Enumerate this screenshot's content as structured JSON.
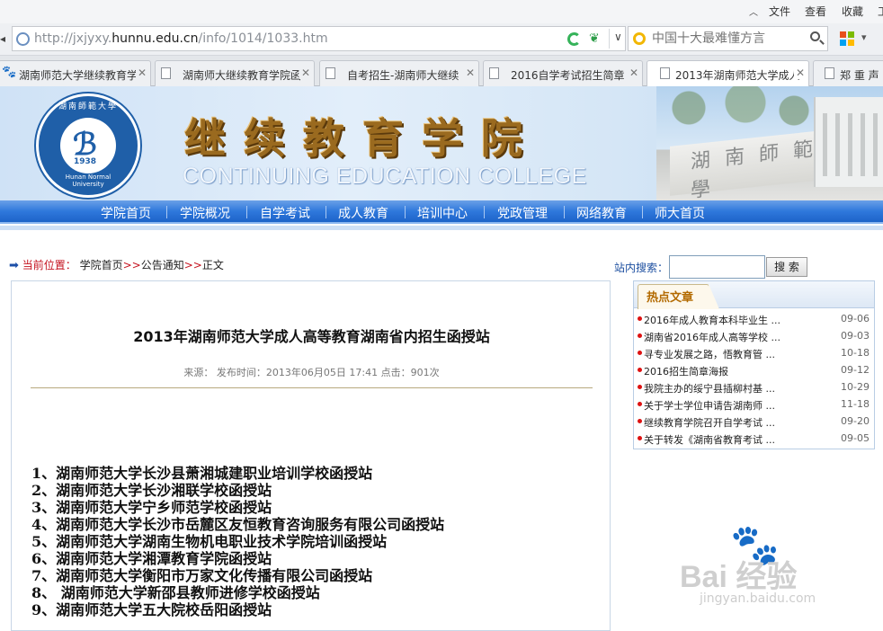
{
  "browser": {
    "menu": [
      "文件",
      "查看",
      "收藏",
      "工"
    ],
    "address": {
      "url_host": "http://jxjyxy.",
      "url_domain": "hunnu.edu.cn",
      "url_path": "/info/1014/1033.htm"
    },
    "search": {
      "placeholder": "中国十大最难懂方言"
    },
    "tabs": [
      {
        "label": "湖南师范大学继续教育学"
      },
      {
        "label": "湖南师大继续教育学院函"
      },
      {
        "label": "自考招生-湖南师大继续"
      },
      {
        "label": "2016自学考试招生简章"
      },
      {
        "label": "2013年湖南师范大学成人"
      },
      {
        "label": "郑 重 声"
      }
    ]
  },
  "banner": {
    "seal_cn": "湖南師範大學",
    "seal_year": "1938",
    "seal_en": "Hunan Normal University",
    "college_cn": "继续教育学院",
    "college_en": "CONTINUING EDUCATION COLLEGE",
    "wall_text": "湖南師範大學"
  },
  "nav": [
    "学院首页",
    "学院概况",
    "自学考试",
    "成人教育",
    "培训中心",
    "党政管理",
    "网络教育",
    "师大首页"
  ],
  "breadcrumb": {
    "prefix": "当前位置：",
    "home": "学院首页",
    "section": "公告通知",
    "current": "正文",
    "sep": ">>"
  },
  "site_search": {
    "label": "站内搜索：",
    "button": "搜 索"
  },
  "article": {
    "title": "2013年湖南师范大学成人高等教育湖南省内招生函授站",
    "meta": "来源：  发布时间：2013年06月05日 17:41  点击：901次",
    "items": [
      "1、湖南师范大学长沙县萧湘城建职业培训学校函授站",
      "2、湖南师范大学长沙湘联学校函授站",
      "3、湖南师范大学宁乡师范学校函授站",
      "4、湖南师范大学长沙市岳麓区友恒教育咨询服务有限公司函授站",
      "5、湖南师范大学湖南生物机电职业技术学院培训函授站",
      "6、湖南师范大学湘潭教育学院函授站",
      "7、湖南师范大学衡阳市万家文化传播有限公司函授站",
      "8、 湖南师范大学新邵县教师进修学校函授站",
      "9、湖南师范大学五大院校岳阳函授站"
    ]
  },
  "hot": {
    "title": "热点文章",
    "items": [
      {
        "title": "2016年成人教育本科毕业生 ...",
        "date": "09-06"
      },
      {
        "title": "湖南省2016年成人高等学校 ...",
        "date": "09-03"
      },
      {
        "title": "寻专业发展之路，悟教育管 ...",
        "date": "10-18"
      },
      {
        "title": "2016招生简章海报",
        "date": "09-12"
      },
      {
        "title": "我院主办的绥宁县插柳村基 ...",
        "date": "10-29"
      },
      {
        "title": "关于学士学位申请告湖南师 ...",
        "date": "11-18"
      },
      {
        "title": "继续教育学院召开自学考试 ...",
        "date": "09-20"
      },
      {
        "title": "关于转发《湖南省教育考试 ...",
        "date": "09-05"
      }
    ]
  },
  "watermark": {
    "text": "Bai 经验",
    "url": "jingyan.baidu.com"
  }
}
